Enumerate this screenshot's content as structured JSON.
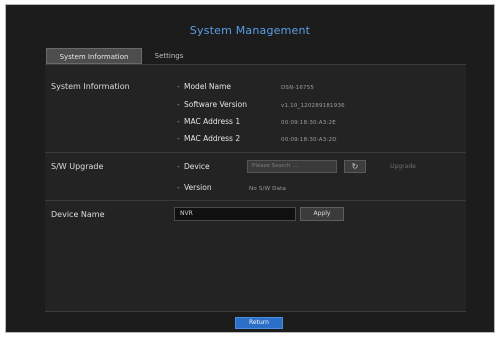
{
  "window": {
    "title": "System Management"
  },
  "tabs": [
    {
      "label": "System Information",
      "active": true
    },
    {
      "label": "Settings",
      "active": false
    }
  ],
  "system_information": {
    "section_label": "System Information",
    "rows": [
      {
        "label": "Model Name",
        "value": "DSN-16755"
      },
      {
        "label": "Software Version",
        "value": "v1.10_120289181936"
      },
      {
        "label": "MAC Address 1",
        "value": "00:09:18:30:A3:2E"
      },
      {
        "label": "MAC Address 2",
        "value": "00:09:18:30:A3:2D"
      }
    ]
  },
  "sw_upgrade": {
    "section_label": "S/W Upgrade",
    "device_label": "Device",
    "device_placeholder": "Please Search ...",
    "refresh_icon": "refresh-icon",
    "upgrade_label": "Upgrade",
    "version_label": "Version",
    "version_value": "No S/W Data"
  },
  "device_name": {
    "section_label": "Device Name",
    "value": "NVR",
    "apply_label": "Apply"
  },
  "footer": {
    "return_label": "Return"
  },
  "colors": {
    "title": "#5a9fe6",
    "background": "#1c1c1c",
    "panel": "#232323",
    "return_button": "#2c6fc9"
  }
}
